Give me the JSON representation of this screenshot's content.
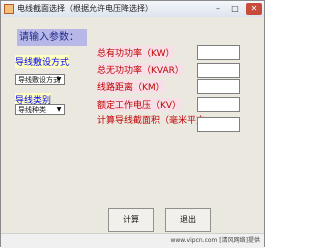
{
  "window": {
    "title": "电线截面选择（根据允许电压降选择）",
    "minimize_glyph": "–",
    "maximize_glyph": "□",
    "close_glyph": "✕"
  },
  "prompt": {
    "title": "请输入参数："
  },
  "wiring": {
    "section_label": "导线敷设方式",
    "selected": "导线敷设方式"
  },
  "wire_type": {
    "section_label": "导线类别",
    "selected": "导线种类"
  },
  "fields": {
    "total_active_power": "总有功功率（KW）",
    "total_reactive_power": "总无功功率（KVAR）",
    "line_distance": "线路距离（KM）",
    "rated_voltage": "额定工作电压（KV）",
    "cross_section": "计算导线截面积（毫米平方"
  },
  "buttons": {
    "calculate": "计算",
    "exit": "退出"
  },
  "watermark": "www.vipcn.com [清风网络]提供"
}
